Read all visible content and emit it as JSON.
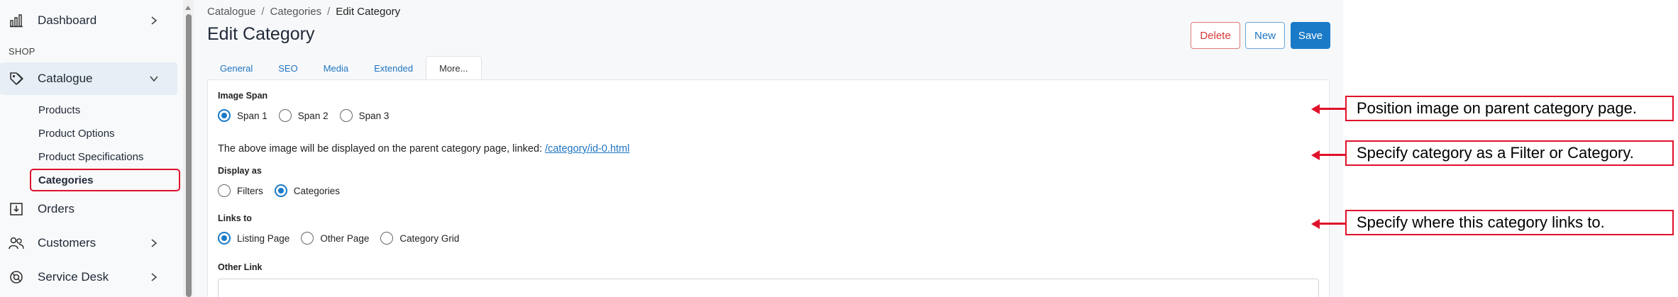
{
  "sidebar": {
    "items": [
      {
        "label": "Dashboard",
        "icon": "dashboard-icon"
      },
      {
        "label": "Catalogue",
        "icon": "tag-icon"
      },
      {
        "label": "Orders",
        "icon": "box-icon"
      },
      {
        "label": "Customers",
        "icon": "users-icon"
      },
      {
        "label": "Service Desk",
        "icon": "support-icon"
      }
    ],
    "section_label": "SHOP",
    "sub_items": [
      "Products",
      "Product Options",
      "Product Specifications",
      "Categories"
    ]
  },
  "breadcrumb": [
    "Catalogue",
    "Categories",
    "Edit Category"
  ],
  "page_title": "Edit Category",
  "buttons": {
    "delete": "Delete",
    "new": "New",
    "save": "Save"
  },
  "tabs": [
    "General",
    "SEO",
    "Media",
    "Extended",
    "More..."
  ],
  "form": {
    "image_span": {
      "label": "Image Span",
      "options": [
        "Span 1",
        "Span 2",
        "Span 3"
      ],
      "selected": "Span 1"
    },
    "info_text": "The above image will be displayed on the parent category page, linked: ",
    "info_link": "/category/id-0.html",
    "display_as": {
      "label": "Display as",
      "options": [
        "Filters",
        "Categories"
      ],
      "selected": "Categories"
    },
    "links_to": {
      "label": "Links to",
      "options": [
        "Listing Page",
        "Other Page",
        "Category Grid"
      ],
      "selected": "Listing Page"
    },
    "other_link": {
      "label": "Other Link",
      "value": ""
    }
  },
  "annotations": [
    "Position image on parent category page.",
    "Specify category as a Filter or Category.",
    "Specify where this category links to."
  ],
  "colors": {
    "accent": "#1a7ac7",
    "annotation": "#e0112b",
    "danger": "#d63939"
  }
}
